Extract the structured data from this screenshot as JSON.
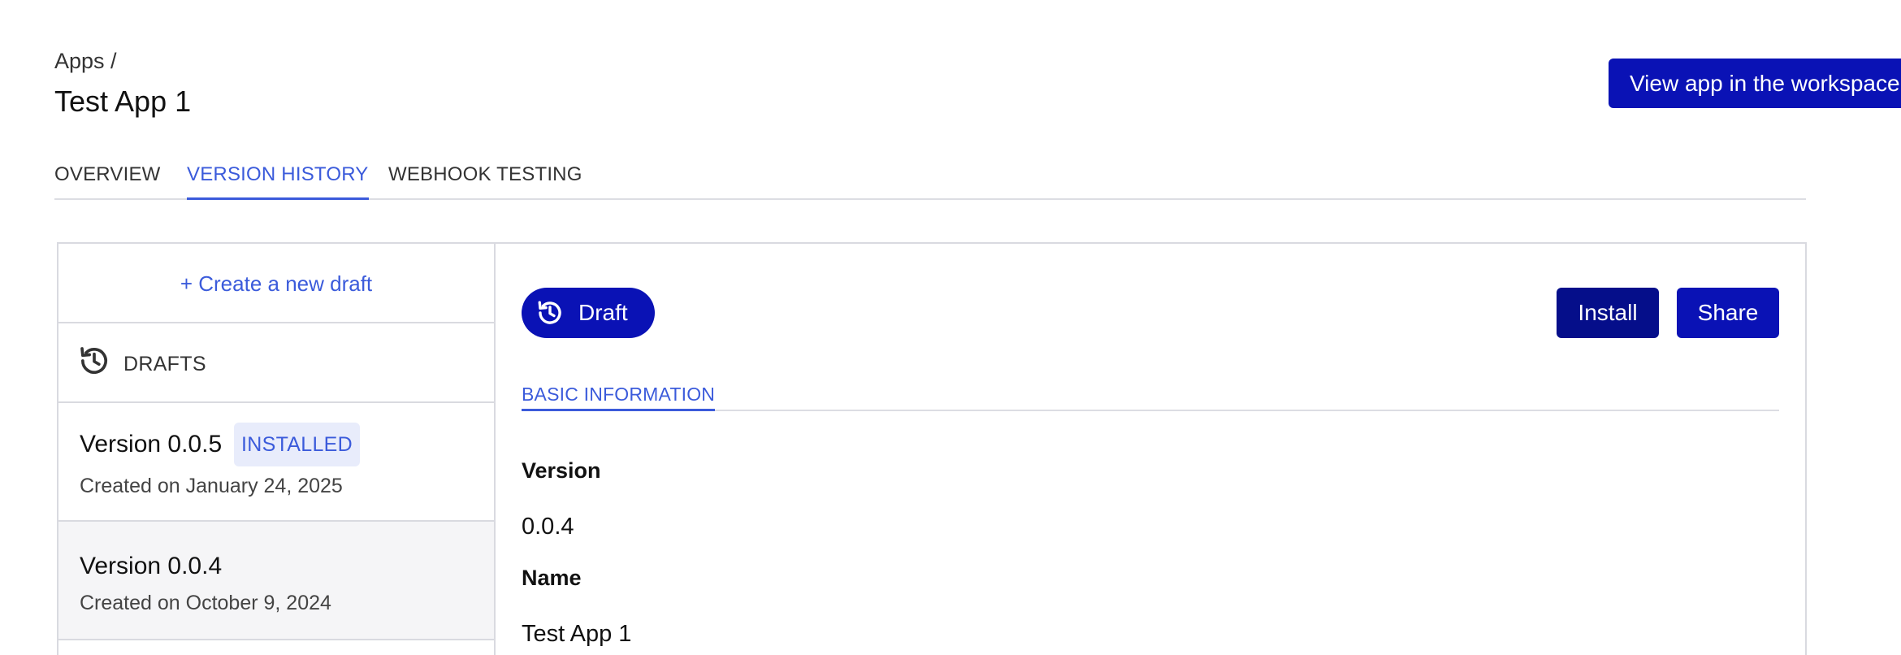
{
  "header": {
    "breadcrumb": "Apps /",
    "title": "Test App 1",
    "view_button": "View app in the workspace"
  },
  "tabs": [
    {
      "label": "OVERVIEW",
      "active": false
    },
    {
      "label": "VERSION HISTORY",
      "active": true
    },
    {
      "label": "WEBHOOK TESTING",
      "active": false
    }
  ],
  "sidebar": {
    "create_draft": "+ Create a new draft",
    "drafts_label": "DRAFTS",
    "drafts_icon": "history-icon",
    "versions": [
      {
        "name": "Version 0.0.5",
        "badge": "INSTALLED",
        "date": "Created on January 24, 2025"
      },
      {
        "name": "Version 0.0.4",
        "badge": "",
        "date": "Created on October 9, 2024"
      }
    ]
  },
  "detail": {
    "status_pill": "Draft",
    "status_icon": "history-icon",
    "install_button": "Install",
    "share_button": "Share",
    "subtab": "BASIC INFORMATION",
    "fields": [
      {
        "label": "Version",
        "value": "0.0.4"
      },
      {
        "label": "Name",
        "value": "Test App 1"
      }
    ]
  },
  "colors": {
    "primary": "#0a12b5",
    "primary_dark": "#050e8a",
    "link": "#3b5bdb",
    "badge_bg": "#e8ecfb",
    "border": "#d9dae0"
  }
}
